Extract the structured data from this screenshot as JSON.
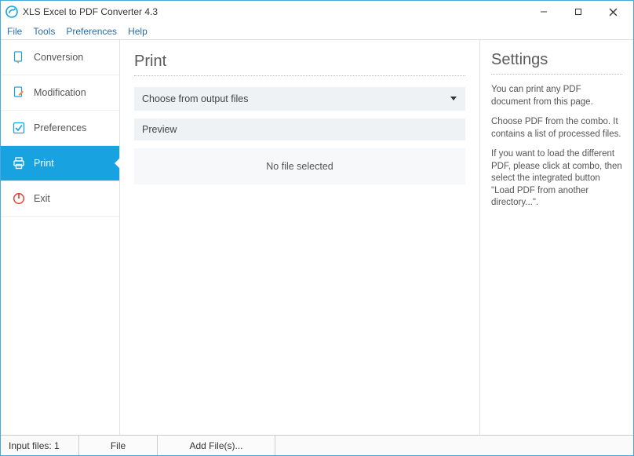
{
  "titlebar": {
    "title": "XLS Excel to PDF Converter 4.3"
  },
  "menubar": {
    "file": "File",
    "tools": "Tools",
    "preferences": "Preferences",
    "help": "Help"
  },
  "sidebar": {
    "items": [
      {
        "label": "Conversion"
      },
      {
        "label": "Modification"
      },
      {
        "label": "Preferences"
      },
      {
        "label": "Print"
      },
      {
        "label": "Exit"
      }
    ]
  },
  "main": {
    "title": "Print",
    "combo_label": "Choose from output files",
    "preview_label": "Preview",
    "preview_placeholder": "No file selected"
  },
  "settings": {
    "title": "Settings",
    "p1": "You can print any PDF document from this page.",
    "p2": "Choose PDF from the combo. It contains a list of processed files.",
    "p3": "If you want to load the different PDF, please click at combo, then select the integrated button \"Load PDF from another directory...\"."
  },
  "statusbar": {
    "input_files": "Input files: 1",
    "file_btn": "File",
    "add_files_btn": "Add File(s)..."
  }
}
